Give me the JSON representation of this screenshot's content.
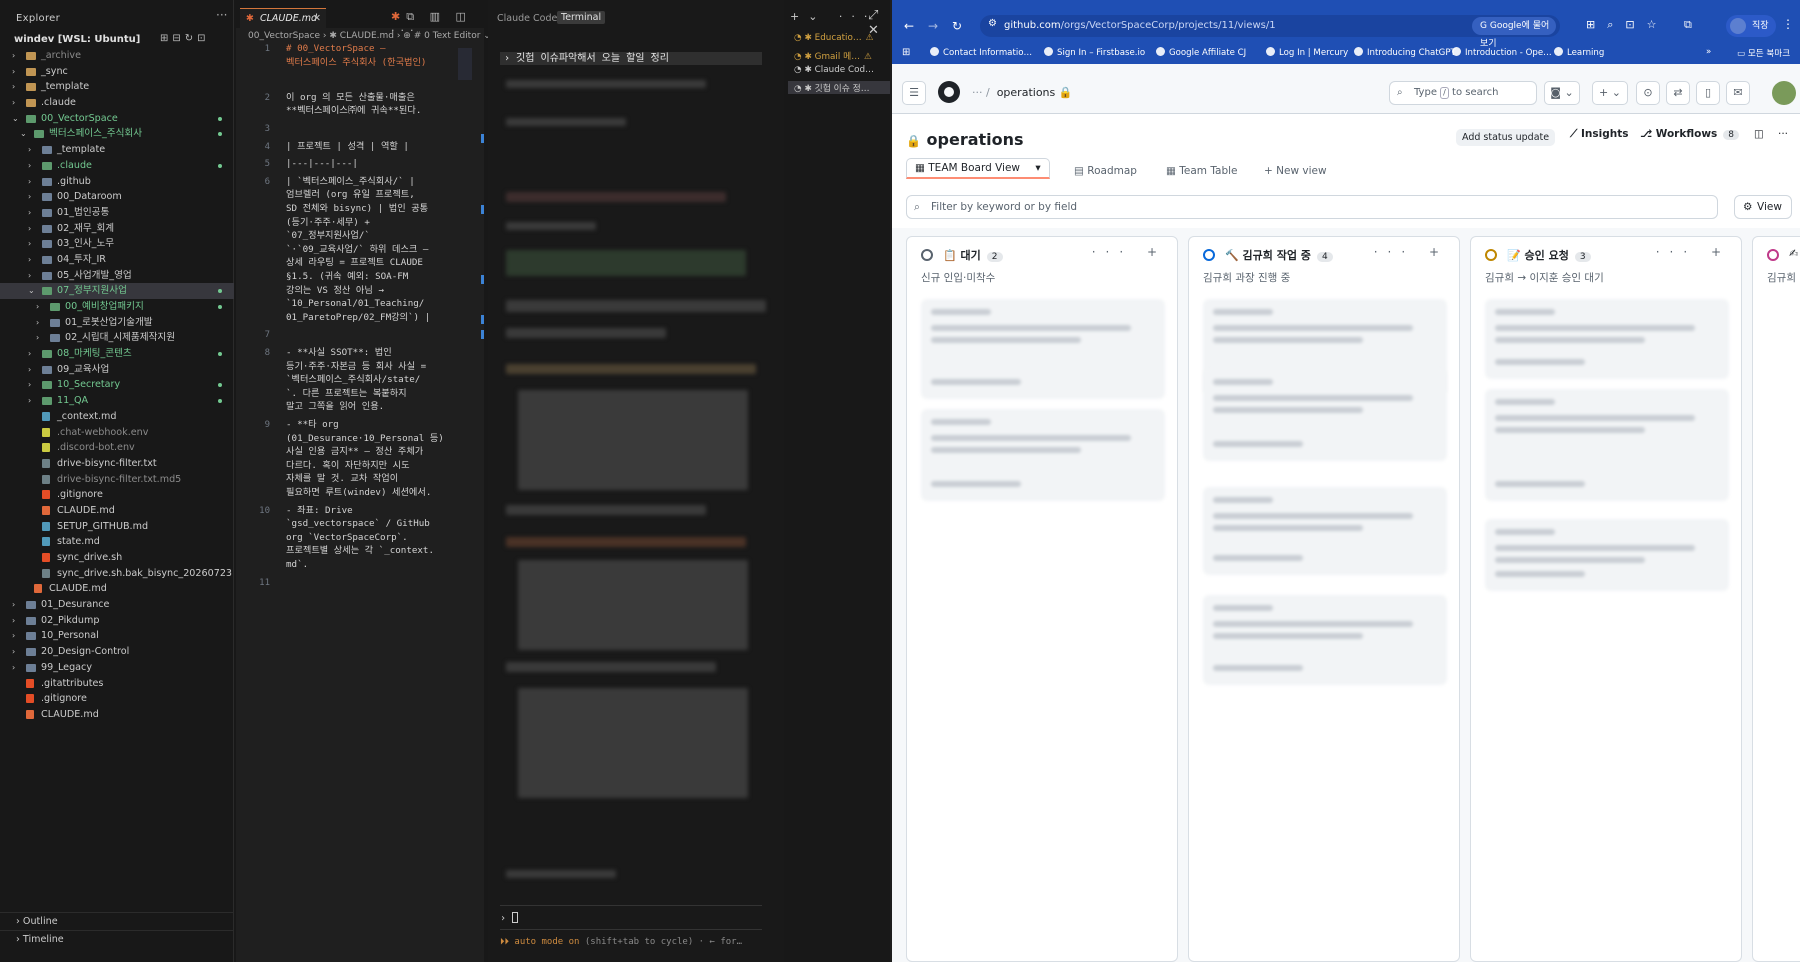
{
  "vscode": {
    "explorer": {
      "title": "Explorer",
      "root": "windev [WSL: Ubuntu]",
      "items": [
        {
          "label": "_archive",
          "depth": 1,
          "type": "folder",
          "chev": "›",
          "color": "dim"
        },
        {
          "label": "_sync",
          "depth": 1,
          "type": "folder",
          "chev": "›"
        },
        {
          "label": "_template",
          "depth": 1,
          "type": "folder",
          "chev": "›"
        },
        {
          "label": ".claude",
          "depth": 1,
          "type": "folder",
          "chev": "›"
        },
        {
          "label": "00_VectorSpace",
          "depth": 1,
          "type": "folder",
          "chev": "⌄",
          "color": "green",
          "dot": true
        },
        {
          "label": "벡터스페이스_주식회사",
          "depth": 2,
          "type": "folder",
          "chev": "⌄",
          "color": "green",
          "dot": true
        },
        {
          "label": "_template",
          "depth": 3,
          "type": "folder",
          "chev": "›"
        },
        {
          "label": ".claude",
          "depth": 3,
          "type": "folder",
          "chev": "›",
          "color": "green",
          "dot": true
        },
        {
          "label": ".github",
          "depth": 3,
          "type": "folder",
          "chev": "›"
        },
        {
          "label": "00_Dataroom",
          "depth": 3,
          "type": "folder",
          "chev": "›"
        },
        {
          "label": "01_법인공통",
          "depth": 3,
          "type": "folder",
          "chev": "›"
        },
        {
          "label": "02_재무_회계",
          "depth": 3,
          "type": "folder",
          "chev": "›"
        },
        {
          "label": "03_인사_노무",
          "depth": 3,
          "type": "folder",
          "chev": "›"
        },
        {
          "label": "04_투자_IR",
          "depth": 3,
          "type": "folder",
          "chev": "›"
        },
        {
          "label": "05_사업개발_영업",
          "depth": 3,
          "type": "folder",
          "chev": "›"
        },
        {
          "label": "07_정부지원사업",
          "depth": 3,
          "type": "folder",
          "chev": "⌄",
          "color": "green",
          "dot": true,
          "selected": true
        },
        {
          "label": "00_예비창업패키지",
          "depth": 4,
          "type": "folder",
          "chev": "›",
          "color": "green",
          "dot": true
        },
        {
          "label": "01_로봇산업기술개발",
          "depth": 4,
          "type": "folder",
          "chev": "›"
        },
        {
          "label": "02_시립대_시제품제작지원",
          "depth": 4,
          "type": "folder",
          "chev": "›"
        },
        {
          "label": "08_마케팅_콘텐츠",
          "depth": 3,
          "type": "folder",
          "chev": "›",
          "color": "green",
          "dot": true
        },
        {
          "label": "09_교육사업",
          "depth": 3,
          "type": "folder",
          "chev": "›"
        },
        {
          "label": "10_Secretary",
          "depth": 3,
          "type": "folder",
          "chev": "›",
          "color": "green",
          "dot": true
        },
        {
          "label": "11_QA",
          "depth": 3,
          "type": "folder",
          "chev": "›",
          "color": "green",
          "dot": true
        },
        {
          "label": "_context.md",
          "depth": 3,
          "type": "file",
          "icolor": "#519aba"
        },
        {
          "label": ".chat-webhook.env",
          "depth": 3,
          "type": "file",
          "icolor": "#cbcb41",
          "color": "dim"
        },
        {
          "label": ".discord-bot.env",
          "depth": 3,
          "type": "file",
          "icolor": "#cbcb41",
          "color": "dim"
        },
        {
          "label": "drive-bisync-filter.txt",
          "depth": 3,
          "type": "file",
          "icolor": "#6d8086"
        },
        {
          "label": "drive-bisync-filter.txt.md5",
          "depth": 3,
          "type": "file",
          "icolor": "#6d8086",
          "color": "dim"
        },
        {
          "label": ".gitignore",
          "depth": 3,
          "type": "file",
          "icolor": "#e44d26"
        },
        {
          "label": "CLAUDE.md",
          "depth": 3,
          "type": "file",
          "icolor": "#e0683a"
        },
        {
          "label": "SETUP_GITHUB.md",
          "depth": 3,
          "type": "file",
          "icolor": "#519aba"
        },
        {
          "label": "state.md",
          "depth": 3,
          "type": "file",
          "icolor": "#519aba"
        },
        {
          "label": "sync_drive.sh",
          "depth": 3,
          "type": "file",
          "icolor": "#e44d26"
        },
        {
          "label": "sync_drive.sh.bak_bisync_20260723",
          "depth": 3,
          "type": "file",
          "icolor": "#6d8086"
        },
        {
          "label": "CLAUDE.md",
          "depth": 2,
          "type": "file",
          "icolor": "#e0683a"
        },
        {
          "label": "01_Desurance",
          "depth": 1,
          "type": "folder",
          "chev": "›"
        },
        {
          "label": "02_Pikdump",
          "depth": 1,
          "type": "folder",
          "chev": "›"
        },
        {
          "label": "10_Personal",
          "depth": 1,
          "type": "folder",
          "chev": "›"
        },
        {
          "label": "20_Design-Control",
          "depth": 1,
          "type": "folder",
          "chev": "›"
        },
        {
          "label": "99_Legacy",
          "depth": 1,
          "type": "folder",
          "chev": "›"
        },
        {
          "label": ".gitattributes",
          "depth": 1,
          "type": "file",
          "icolor": "#e44d26"
        },
        {
          "label": ".gitignore",
          "depth": 1,
          "type": "file",
          "icolor": "#e44d26"
        },
        {
          "label": "CLAUDE.md",
          "depth": 1,
          "type": "file",
          "icolor": "#e0683a"
        }
      ],
      "outline": "Outline",
      "timeline": "Timeline"
    },
    "editor": {
      "tab": "CLAUDE.md",
      "breadcrumb": "00_VectorSpace › ✱ CLAUDE.md › ⊕ # 0 Text Editor ⌄",
      "lines": [
        {
          "n": "1",
          "text": "# 00_VectorSpace —\n벡터스페이스 주식회사 (한국법인)",
          "cls": "h1"
        },
        {
          "n": "",
          "text": ""
        },
        {
          "n": "2",
          "text": "이 org 의 모든 산출물·매출은\n**벡터스페이스㈜에 귀속**된다."
        },
        {
          "n": "3",
          "text": ""
        },
        {
          "n": "4",
          "text": "| 프로젝트 | 성격 | 역할 |"
        },
        {
          "n": "5",
          "text": "|---|---|---|"
        },
        {
          "n": "6",
          "text": "| `벡터스페이스_주식회사/` |\n엄브렐러 (org 유일 프로젝트,\nSD 전체와 bisync) | 법인 공통\n(등기·주주·세무) +\n`07_정부지원사업/`\n`·`09_교육사업/` 하위 데스크 —\n상세 라우팅 = 프로젝트 CLAUDE\n§1.5. (귀속 예외: SOA-FM\n강의는 VS 정산 아님 →\n`10_Personal/01_Teaching/\n01_ParetoPrep/02_FM강의`) |"
        },
        {
          "n": "7",
          "text": ""
        },
        {
          "n": "8",
          "text": "- **사실 SSOT**: 법인\n등기·주주·자본금 등 회사 사실 =\n`벡터스페이스_주식회사/state/\n`. 다른 프로젝트는 복붙하지\n말고 그쪽을 읽어 인용."
        },
        {
          "n": "9",
          "text": "- **타 org\n(01_Desurance·10_Personal 등)\n사실 인용 금지** — 정산 주체가\n다르다. 혹이 자단하지만 시도\n자체를 말 것. 교차 작업이\n필요하면 루트(windev) 세션에서."
        },
        {
          "n": "10",
          "text": "- 좌표: Drive\n`gsd_vectorspace` / GitHub\norg `VectorSpaceCorp`.\n프로젝트별 상세는 각 `_context.\nmd`."
        },
        {
          "n": "11",
          "text": ""
        }
      ]
    },
    "terminal": {
      "tabs": [
        "Claude Code",
        "Terminal"
      ],
      "prompt": "› 깃헙 이슈파악해서 오늘 할일 정리",
      "input_caret": "›",
      "auto_mode": "⏵⏵ auto mode on",
      "auto_hint": "(shift+tab to cycle) · ← for…"
    },
    "sessions": [
      {
        "label": "Educatio…",
        "warn": "⚠"
      },
      {
        "label": "Gmail 메…",
        "warn": "⚠"
      },
      {
        "label": "Claude Cod…",
        "warn": ""
      },
      {
        "label": "깃헙 이슈 정…",
        "warn": ""
      }
    ]
  },
  "browser": {
    "url_host": "github.com",
    "url_path": "/orgs/VectorSpaceCorp/projects/11/views/1",
    "google_btn": "Google에 물어보기",
    "profile": "직장",
    "bookmarks": [
      "Contact Informatio…",
      "Sign In – Firstbase.io",
      "Google Affiliate CJ",
      "Log In | Mercury",
      "Introducing ChatGPT",
      "Introduction - Ope…",
      "Learning"
    ],
    "all_bookmarks": "모든 북마크",
    "github": {
      "breadcrumb": "operations",
      "search_pre": "Type",
      "search_key": "/",
      "search_post": "to search",
      "project_title": "operations",
      "add_status": "Add status update",
      "insights": "Insights",
      "workflows": "Workflows",
      "workflows_count": "8",
      "views": [
        "TEAM Board View",
        "Roadmap",
        "Team Table",
        "New view"
      ],
      "filter_placeholder": "Filter by keyword or by field",
      "view_btn": "View",
      "columns": [
        {
          "name": "대기",
          "emoji": "📋",
          "count": "2",
          "desc": "신규 인입·미착수",
          "color": "#59636e"
        },
        {
          "name": "김규희 작업 중",
          "emoji": "🔨",
          "count": "4",
          "desc": "김규희 과장 진행 중",
          "color": "#0969da"
        },
        {
          "name": "승인 요청",
          "emoji": "📝",
          "count": "3",
          "desc": "김규희 → 이지훈 승인 대기",
          "color": "#bf8700"
        },
        {
          "name": "",
          "emoji": "✍",
          "count": "",
          "desc": "김규희",
          "color": "#bf3989"
        }
      ]
    }
  }
}
